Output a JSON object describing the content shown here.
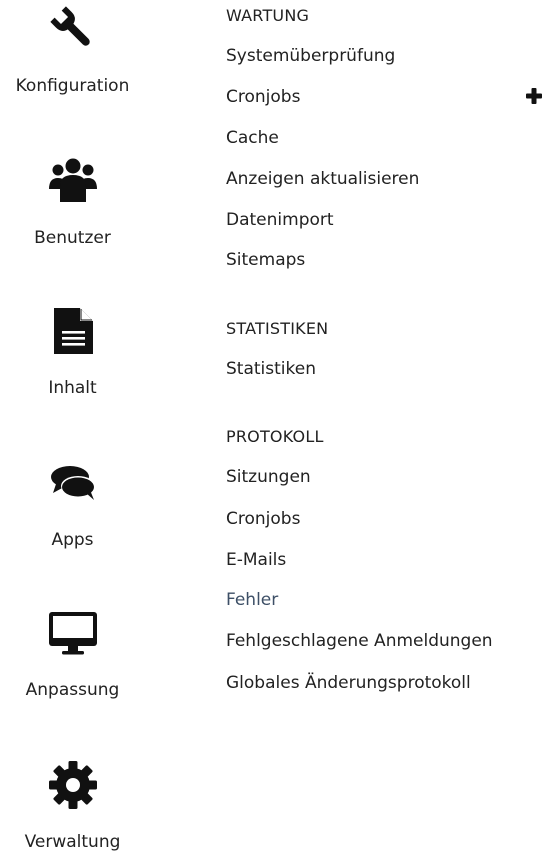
{
  "sidebar": {
    "items": [
      {
        "label": "Konfiguration",
        "icon": "wrench-icon"
      },
      {
        "label": "Benutzer",
        "icon": "users-icon"
      },
      {
        "label": "Inhalt",
        "icon": "document-icon"
      },
      {
        "label": "Apps",
        "icon": "comments-icon"
      },
      {
        "label": "Anpassung",
        "icon": "desktop-icon"
      },
      {
        "label": "Verwaltung",
        "icon": "gear-icon"
      }
    ]
  },
  "menu": {
    "wartung": {
      "heading": "WARTUNG",
      "links": [
        "Systemüberprüfung",
        "Cronjobs",
        "Cache",
        "Anzeigen aktualisieren",
        "Datenimport",
        "Sitemaps"
      ]
    },
    "statistiken": {
      "heading": "STATISTIKEN",
      "links": [
        "Statistiken"
      ]
    },
    "protokoll": {
      "heading": "PROTOKOLL",
      "links": [
        "Sitzungen",
        "Cronjobs",
        "E-Mails",
        "Fehler",
        "Fehlgeschlagene Anmeldungen",
        "Globales Änderungsprotokoll"
      ]
    }
  },
  "colors": {
    "text": "#222222",
    "active_link": "#3d4f66",
    "icon": "#111111"
  },
  "icons": {
    "add": "plus-icon"
  }
}
